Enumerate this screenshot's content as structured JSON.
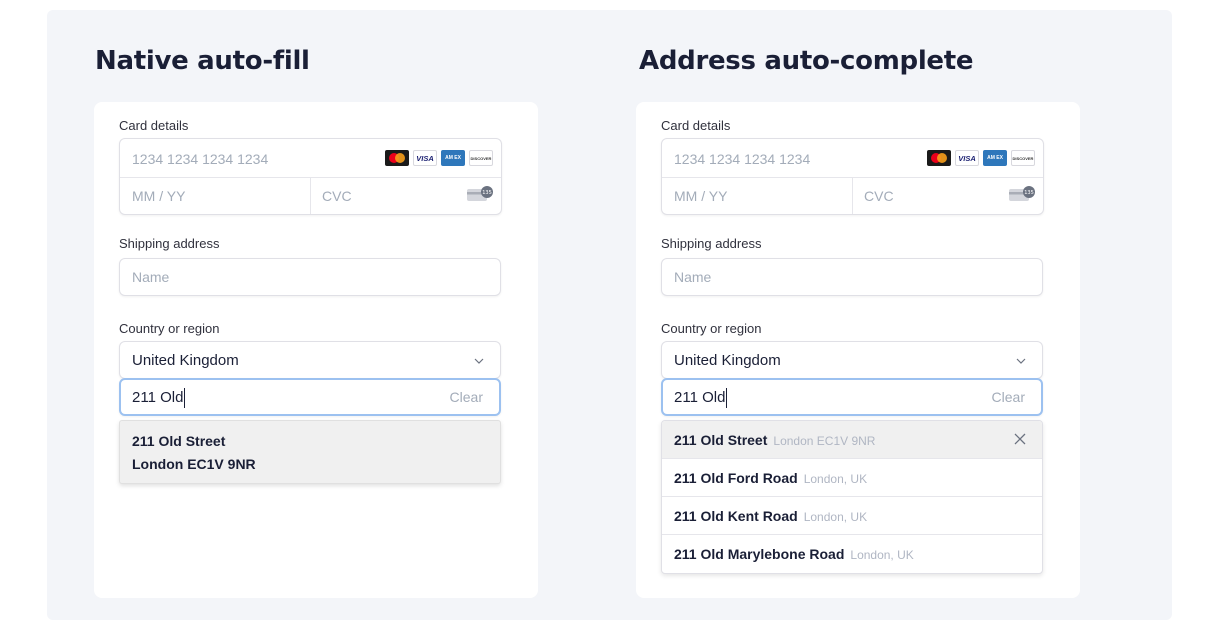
{
  "left": {
    "title": "Native auto-fill",
    "card_label": "Card details",
    "card_number_placeholder": "1234 1234 1234 1234",
    "expiry_placeholder": "MM / YY",
    "cvc_placeholder": "CVC",
    "cvc_icon_text": "135",
    "shipping_label": "Shipping address",
    "name_placeholder": "Name",
    "country_label": "Country or region",
    "country_value": "United Kingdom",
    "address_value": "211 Old",
    "clear_label": "Clear",
    "suggestion_line1": "211 Old Street",
    "suggestion_line2": "London EC1V 9NR"
  },
  "right": {
    "title": "Address auto-complete",
    "card_label": "Card details",
    "card_number_placeholder": "1234 1234 1234 1234",
    "expiry_placeholder": "MM / YY",
    "cvc_placeholder": "CVC",
    "cvc_icon_text": "135",
    "shipping_label": "Shipping address",
    "name_placeholder": "Name",
    "country_label": "Country or region",
    "country_value": "United Kingdom",
    "address_value": "211 Old",
    "clear_label": "Clear",
    "suggestions": [
      {
        "main": "211 Old Street",
        "sub": "London EC1V 9NR"
      },
      {
        "main": "211 Old Ford Road",
        "sub": "London, UK"
      },
      {
        "main": "211 Old Kent Road",
        "sub": "London, UK"
      },
      {
        "main": "211 Old Marylebone Road",
        "sub": "London, UK"
      }
    ]
  },
  "brands": {
    "visa": "VISA",
    "amex": "AM EX",
    "discover": "DISCOVER"
  },
  "icons": {
    "mastercard": "mastercard-icon",
    "visa": "visa-icon",
    "amex": "amex-icon",
    "discover": "discover-icon",
    "cvc": "cvc-card-icon",
    "chevron": "chevron-down-icon",
    "close": "close-icon"
  },
  "colors": {
    "stage_bg": "#f3f5f9",
    "focus_border": "#9cc1f0",
    "highlight_row": "#f0f0f0",
    "text": "#1a1f36",
    "placeholder": "#a3acb9"
  }
}
